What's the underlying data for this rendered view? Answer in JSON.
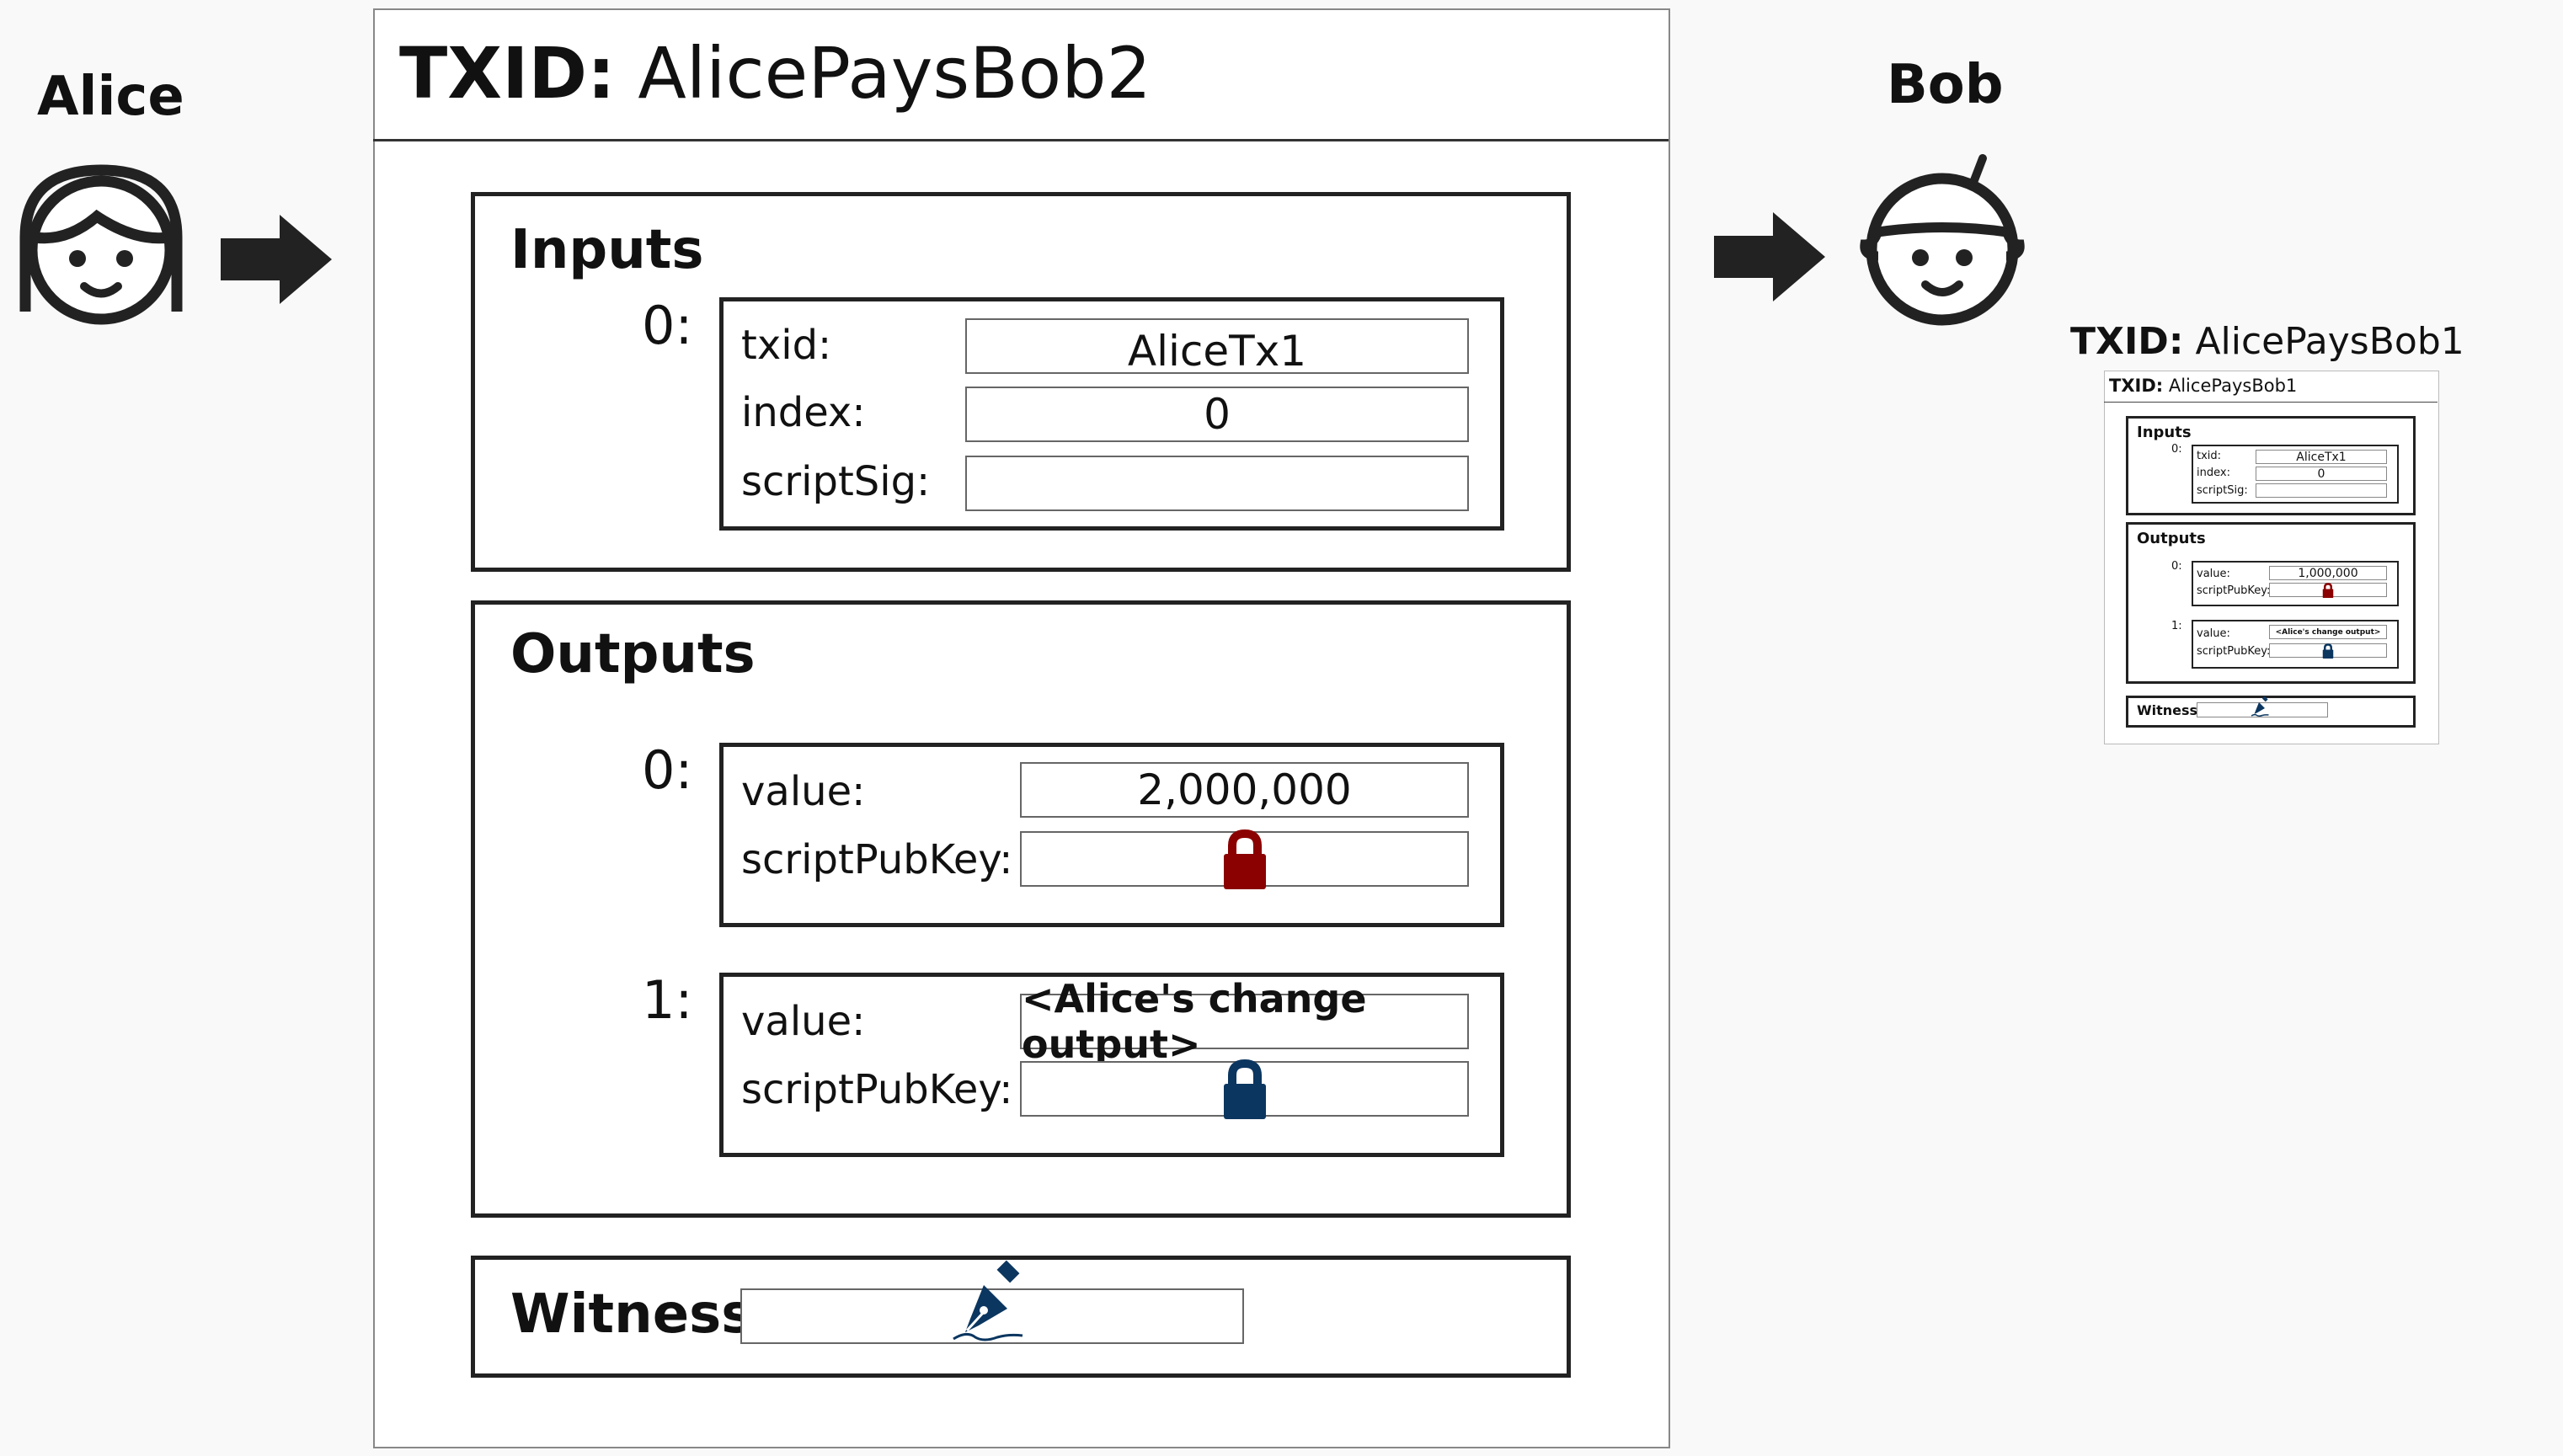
{
  "alice": {
    "name": "Alice"
  },
  "bob": {
    "name": "Bob"
  },
  "main_tx": {
    "title_prefix": "TXID:",
    "title_id": "AlicePaysBob2",
    "inputs": {
      "title": "Inputs",
      "items": [
        {
          "index": "0:",
          "txid_label": "txid:",
          "txid": "AliceTx1",
          "index_label": "index:",
          "index_value": "0",
          "scriptsig_label": "scriptSig:",
          "scriptsig": ""
        }
      ]
    },
    "outputs": {
      "title": "Outputs",
      "items": [
        {
          "index": "0:",
          "value_label": "value:",
          "value": "2,000,000",
          "spk_label": "scriptPubKey:",
          "lock_color": "#8b0000"
        },
        {
          "index": "1:",
          "value_label": "value:",
          "value": "<Alice's change output>",
          "spk_label": "scriptPubKey:",
          "lock_color": "#0b3660"
        }
      ]
    },
    "witness": {
      "title": "Witness",
      "icon": "pen-signature-icon"
    }
  },
  "mini_tx": {
    "caption_prefix": "TXID:",
    "caption_id": "AlicePaysBob1",
    "title_prefix": "TXID:",
    "title_id": "AlicePaysBob1",
    "inputs": {
      "title": "Inputs",
      "index": "0:",
      "txid_label": "txid:",
      "txid": "AliceTx1",
      "index_label": "index:",
      "index_value": "0",
      "scriptsig_label": "scriptSig:"
    },
    "outputs": {
      "title": "Outputs",
      "items": [
        {
          "index": "0:",
          "value_label": "value:",
          "value": "1,000,000",
          "spk_label": "scriptPubKey:",
          "lock_color": "#8b0000"
        },
        {
          "index": "1:",
          "value_label": "value:",
          "value": "<Alice's change output>",
          "spk_label": "scriptPubKey:",
          "lock_color": "#0b3660"
        }
      ]
    },
    "witness": {
      "title": "Witness"
    }
  },
  "colors": {
    "arrow": "#222222",
    "icon_stroke": "#222222",
    "pen": "#0b3660"
  }
}
